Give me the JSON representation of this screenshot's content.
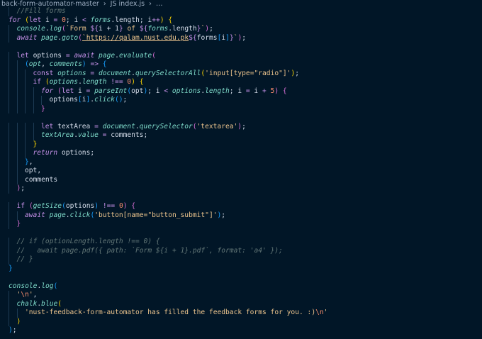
{
  "breadcrumb": "back-form-automator-master  ›  JS index.js  ›  …",
  "colors": {
    "background": "#011627"
  },
  "lines": [
    {
      "indent": 1,
      "tokens": [
        [
          "c",
          "//Fill forms"
        ]
      ]
    },
    {
      "indent": 0,
      "tokens": [
        [
          "k",
          "for"
        ],
        [
          "p",
          " "
        ],
        [
          "b1",
          "("
        ],
        [
          "kl",
          "let"
        ],
        [
          "v",
          " i "
        ],
        [
          "o",
          "="
        ],
        [
          "p",
          " "
        ],
        [
          "n",
          "0"
        ],
        [
          "p",
          "; i "
        ],
        [
          "o",
          "<"
        ],
        [
          "p",
          " "
        ],
        [
          "vi",
          "forms"
        ],
        [
          "p",
          ".length; i"
        ],
        [
          "o",
          "++"
        ],
        [
          "b1",
          ")"
        ],
        [
          "p",
          " "
        ],
        [
          "b1",
          "{"
        ]
      ]
    },
    {
      "indent": 1,
      "tokens": [
        [
          "f",
          "console"
        ],
        [
          "p",
          "."
        ],
        [
          "f",
          "log"
        ],
        [
          "b2",
          "("
        ],
        [
          "s",
          "`Form "
        ],
        [
          "kl",
          "${"
        ],
        [
          "v",
          "i + 1"
        ],
        [
          "kl",
          "}"
        ],
        [
          "s",
          " of "
        ],
        [
          "kl",
          "${"
        ],
        [
          "vi",
          "forms"
        ],
        [
          "p",
          ".length"
        ],
        [
          "kl",
          "}"
        ],
        [
          "s",
          "`"
        ],
        [
          "b2",
          ")"
        ],
        [
          "p",
          ";"
        ]
      ]
    },
    {
      "indent": 1,
      "tokens": [
        [
          "k",
          "await"
        ],
        [
          "p",
          " "
        ],
        [
          "f",
          "page"
        ],
        [
          "p",
          "."
        ],
        [
          "f",
          "goto"
        ],
        [
          "b2",
          "("
        ],
        [
          "u",
          "`https://qalam.nust.edu.pk"
        ],
        [
          "kl",
          "${"
        ],
        [
          "v",
          "forms"
        ],
        [
          "b3",
          "["
        ],
        [
          "v",
          "i"
        ],
        [
          "b3",
          "]"
        ],
        [
          "kl",
          "}"
        ],
        [
          "s",
          "`"
        ],
        [
          "b2",
          ")"
        ],
        [
          "p",
          ";"
        ]
      ]
    },
    {
      "indent": 0,
      "tokens": []
    },
    {
      "indent": 1,
      "tokens": [
        [
          "kl",
          "let"
        ],
        [
          "v",
          " options "
        ],
        [
          "o",
          "="
        ],
        [
          "p",
          " "
        ],
        [
          "k",
          "await"
        ],
        [
          "p",
          " "
        ],
        [
          "f",
          "page"
        ],
        [
          "p",
          "."
        ],
        [
          "f",
          "evaluate"
        ],
        [
          "b2",
          "("
        ]
      ]
    },
    {
      "indent": 2,
      "tokens": [
        [
          "b3",
          "("
        ],
        [
          "vi",
          "opt"
        ],
        [
          "p",
          ", "
        ],
        [
          "vi",
          "comments"
        ],
        [
          "b3",
          ")"
        ],
        [
          "p",
          " "
        ],
        [
          "o",
          "=>"
        ],
        [
          "p",
          " "
        ],
        [
          "b3",
          "{"
        ]
      ]
    },
    {
      "indent": 3,
      "tokens": [
        [
          "kl",
          "const"
        ],
        [
          "p",
          " "
        ],
        [
          "vi",
          "options"
        ],
        [
          "p",
          " "
        ],
        [
          "o",
          "="
        ],
        [
          "p",
          " "
        ],
        [
          "f",
          "document"
        ],
        [
          "p",
          "."
        ],
        [
          "f",
          "querySelectorAll"
        ],
        [
          "b1",
          "("
        ],
        [
          "s",
          "'input[type=\"radio\"]'"
        ],
        [
          "b1",
          ")"
        ],
        [
          "p",
          ";"
        ]
      ]
    },
    {
      "indent": 3,
      "tokens": [
        [
          "kl",
          "if"
        ],
        [
          "p",
          " "
        ],
        [
          "b1",
          "("
        ],
        [
          "vi",
          "options"
        ],
        [
          "p",
          "."
        ],
        [
          "vi",
          "length"
        ],
        [
          "p",
          " "
        ],
        [
          "o",
          "!=="
        ],
        [
          "p",
          " "
        ],
        [
          "n",
          "0"
        ],
        [
          "b1",
          ")"
        ],
        [
          "p",
          " "
        ],
        [
          "b1",
          "{"
        ]
      ]
    },
    {
      "indent": 4,
      "tokens": [
        [
          "k",
          "for"
        ],
        [
          "p",
          " "
        ],
        [
          "b2",
          "("
        ],
        [
          "kl",
          "let"
        ],
        [
          "v",
          " i "
        ],
        [
          "o",
          "="
        ],
        [
          "p",
          " "
        ],
        [
          "f",
          "parseInt"
        ],
        [
          "b3",
          "("
        ],
        [
          "v",
          "opt"
        ],
        [
          "b3",
          ")"
        ],
        [
          "p",
          "; i "
        ],
        [
          "o",
          "<"
        ],
        [
          "p",
          " "
        ],
        [
          "vi",
          "options"
        ],
        [
          "p",
          "."
        ],
        [
          "vi",
          "length"
        ],
        [
          "p",
          "; i "
        ],
        [
          "o",
          "="
        ],
        [
          "p",
          " i "
        ],
        [
          "o",
          "+"
        ],
        [
          "p",
          " "
        ],
        [
          "n",
          "5"
        ],
        [
          "b2",
          ")"
        ],
        [
          "p",
          " "
        ],
        [
          "b2",
          "{"
        ]
      ]
    },
    {
      "indent": 5,
      "tokens": [
        [
          "v",
          "options"
        ],
        [
          "b3",
          "["
        ],
        [
          "v",
          "i"
        ],
        [
          "b3",
          "]"
        ],
        [
          "p",
          "."
        ],
        [
          "f",
          "click"
        ],
        [
          "b3",
          "()"
        ],
        [
          "p",
          ";"
        ]
      ]
    },
    {
      "indent": 4,
      "tokens": [
        [
          "b2",
          "}"
        ]
      ]
    },
    {
      "indent": 0,
      "tokens": []
    },
    {
      "indent": 4,
      "tokens": [
        [
          "kl",
          "let"
        ],
        [
          "v",
          " textArea "
        ],
        [
          "o",
          "="
        ],
        [
          "p",
          " "
        ],
        [
          "f",
          "document"
        ],
        [
          "p",
          "."
        ],
        [
          "f",
          "querySelector"
        ],
        [
          "b2",
          "("
        ],
        [
          "s",
          "'textarea'"
        ],
        [
          "b2",
          ")"
        ],
        [
          "p",
          ";"
        ]
      ]
    },
    {
      "indent": 4,
      "tokens": [
        [
          "vi",
          "textArea"
        ],
        [
          "p",
          "."
        ],
        [
          "vi",
          "value"
        ],
        [
          "p",
          " "
        ],
        [
          "o",
          "="
        ],
        [
          "v",
          " comments"
        ],
        [
          "p",
          ";"
        ]
      ]
    },
    {
      "indent": 3,
      "tokens": [
        [
          "b1",
          "}"
        ]
      ]
    },
    {
      "indent": 3,
      "tokens": [
        [
          "k",
          "return"
        ],
        [
          "v",
          " options"
        ],
        [
          "p",
          ";"
        ]
      ]
    },
    {
      "indent": 2,
      "tokens": [
        [
          "b3",
          "}"
        ],
        [
          "p",
          ","
        ]
      ]
    },
    {
      "indent": 2,
      "tokens": [
        [
          "v",
          "opt"
        ],
        [
          "p",
          ","
        ]
      ]
    },
    {
      "indent": 2,
      "tokens": [
        [
          "v",
          "comments"
        ]
      ]
    },
    {
      "indent": 1,
      "tokens": [
        [
          "b2",
          ")"
        ],
        [
          "p",
          ";"
        ]
      ]
    },
    {
      "indent": 0,
      "tokens": []
    },
    {
      "indent": 1,
      "tokens": [
        [
          "kl",
          "if"
        ],
        [
          "p",
          " "
        ],
        [
          "b2",
          "("
        ],
        [
          "f",
          "getSize"
        ],
        [
          "b3",
          "("
        ],
        [
          "v",
          "options"
        ],
        [
          "b3",
          ")"
        ],
        [
          "p",
          " "
        ],
        [
          "o",
          "!=="
        ],
        [
          "p",
          " "
        ],
        [
          "n",
          "0"
        ],
        [
          "b2",
          ")"
        ],
        [
          "p",
          " "
        ],
        [
          "b2",
          "{"
        ]
      ]
    },
    {
      "indent": 2,
      "tokens": [
        [
          "k",
          "await"
        ],
        [
          "p",
          " "
        ],
        [
          "f",
          "page"
        ],
        [
          "p",
          "."
        ],
        [
          "f",
          "click"
        ],
        [
          "b3",
          "("
        ],
        [
          "s",
          "'button[name=\"button_submit\"]'"
        ],
        [
          "b3",
          ")"
        ],
        [
          "p",
          ";"
        ]
      ]
    },
    {
      "indent": 1,
      "tokens": [
        [
          "b2",
          "}"
        ]
      ]
    },
    {
      "indent": 0,
      "tokens": []
    },
    {
      "indent": 1,
      "tokens": [
        [
          "c",
          "// if (optionLength.length !== 0) {"
        ]
      ]
    },
    {
      "indent": 1,
      "tokens": [
        [
          "c",
          "//   await page.pdf({ path: `Form ${i + 1}.pdf`, format: 'a4' });"
        ]
      ]
    },
    {
      "indent": 1,
      "tokens": [
        [
          "c",
          "// }"
        ]
      ]
    },
    {
      "indent": 0,
      "tokens": [
        [
          "b3",
          "}"
        ]
      ]
    },
    {
      "indent": 0,
      "tokens": []
    },
    {
      "indent": 0,
      "tokens": [
        [
          "f",
          "console"
        ],
        [
          "p",
          "."
        ],
        [
          "f",
          "log"
        ],
        [
          "b3",
          "("
        ]
      ]
    },
    {
      "indent": 1,
      "tokens": [
        [
          "s",
          "'"
        ],
        [
          "e",
          "\\n"
        ],
        [
          "s",
          "'"
        ],
        [
          "p",
          ","
        ]
      ]
    },
    {
      "indent": 1,
      "tokens": [
        [
          "f",
          "chalk"
        ],
        [
          "p",
          "."
        ],
        [
          "f",
          "blue"
        ],
        [
          "b1",
          "("
        ]
      ]
    },
    {
      "indent": 2,
      "tokens": [
        [
          "s",
          "'nust-feedback-form-automator has filled the feedback forms for you. :)"
        ],
        [
          "e",
          "\\n"
        ],
        [
          "s",
          "'"
        ]
      ]
    },
    {
      "indent": 1,
      "tokens": [
        [
          "b1",
          ")"
        ]
      ]
    },
    {
      "indent": 0,
      "tokens": [
        [
          "b3",
          ")"
        ],
        [
          "p",
          ";"
        ]
      ]
    }
  ]
}
